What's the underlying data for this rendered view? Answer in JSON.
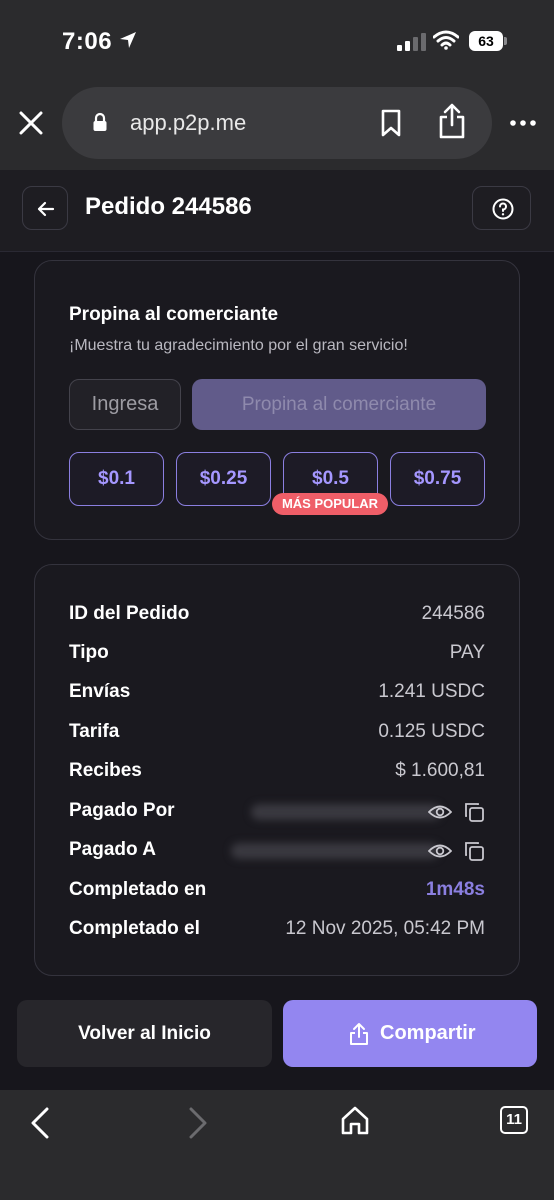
{
  "status_bar": {
    "time": "7:06",
    "battery": "63"
  },
  "browser": {
    "url": "app.p2p.me"
  },
  "header": {
    "title": "Pedido 244586"
  },
  "tip": {
    "title": "Propina al comerciante",
    "subtitle": "¡Muestra tu agradecimiento por el gran servicio!",
    "input_placeholder": "Ingresa",
    "submit_label": "Propina al comerciante",
    "amounts": [
      "$0.1",
      "$0.25",
      "$0.5",
      "$0.75"
    ],
    "popular_badge": "MÁS POPULAR"
  },
  "order": {
    "rows": [
      {
        "label": "ID del Pedido",
        "value": "244586"
      },
      {
        "label": "Tipo",
        "value": "PAY"
      },
      {
        "label": "Envías",
        "value": "1.241 USDC"
      },
      {
        "label": "Tarifa",
        "value": "0.125 USDC"
      },
      {
        "label": "Recibes",
        "value": "$ 1.600,81"
      },
      {
        "label": "Pagado Por",
        "value": ""
      },
      {
        "label": "Pagado A",
        "value": ""
      },
      {
        "label": "Completado en",
        "value": "1m48s"
      },
      {
        "label": "Completado el",
        "value": "12 Nov 2025, 05:42 PM"
      }
    ]
  },
  "actions": {
    "home_label": "Volver al Inicio",
    "share_label": "Compartir"
  },
  "bottom_nav": {
    "tab_count": "11"
  },
  "colors": {
    "accent": "#9386f0",
    "badge": "#ef5e68",
    "background": "#17161c"
  }
}
